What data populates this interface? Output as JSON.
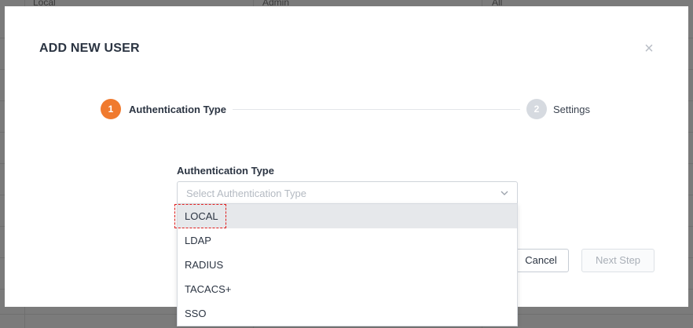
{
  "background": {
    "row_texts": [
      "Local",
      "Admin",
      "All"
    ]
  },
  "modal": {
    "title": "ADD NEW USER",
    "close_icon": "close-icon"
  },
  "stepper": {
    "steps": [
      {
        "number": "1",
        "label": "Authentication Type",
        "state": "active"
      },
      {
        "number": "2",
        "label": "Settings",
        "state": "inactive"
      }
    ]
  },
  "form": {
    "auth_type_label": "Authentication Type",
    "auth_type_placeholder": "Select Authentication Type",
    "auth_type_options": [
      "LOCAL",
      "LDAP",
      "RADIUS",
      "TACACS+",
      "SSO"
    ],
    "highlighted_option": "LOCAL"
  },
  "footer": {
    "cancel_label": "Cancel",
    "next_label": "Next Step"
  },
  "colors": {
    "accent": "#f07a2e",
    "inactive_step": "#d6dae0",
    "highlight": "#e02020"
  }
}
